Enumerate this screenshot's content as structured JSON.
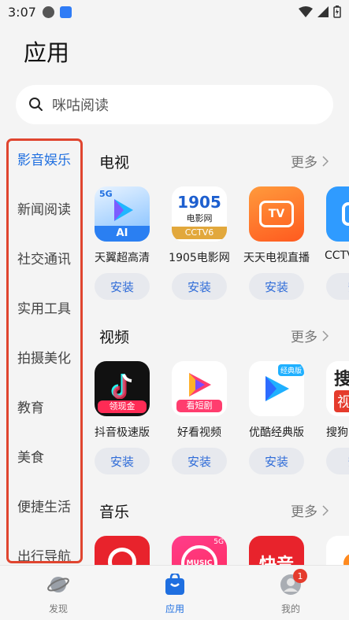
{
  "status_bar": {
    "time": "3:07"
  },
  "page_title": "应用",
  "search": {
    "placeholder": "咪咕阅读"
  },
  "sidebar": {
    "items": [
      {
        "label": "影音娱乐",
        "active": true
      },
      {
        "label": "新闻阅读"
      },
      {
        "label": "社交通讯"
      },
      {
        "label": "实用工具"
      },
      {
        "label": "拍摄美化"
      },
      {
        "label": "教育"
      },
      {
        "label": "美食"
      },
      {
        "label": "便捷生活"
      },
      {
        "label": "出行导航"
      }
    ]
  },
  "sections": [
    {
      "title": "电视",
      "more": "更多",
      "apps": [
        {
          "name": "天翼超高清",
          "install": "安装",
          "icon_badge": "5G",
          "icon_text": "AI"
        },
        {
          "name": "1905电影网",
          "install": "安装",
          "icon_text": "1905",
          "icon_sub": "电影网",
          "icon_tag": "CCTV6"
        },
        {
          "name": "天天电视直播",
          "install": "安装",
          "icon_text": "TV"
        },
        {
          "name": "CCTV",
          "install": "安"
        }
      ]
    },
    {
      "title": "视频",
      "more": "更多",
      "apps": [
        {
          "name": "抖音极速版",
          "install": "安装",
          "icon_tag": "领现金"
        },
        {
          "name": "好看视频",
          "install": "安装",
          "icon_tag": "看短剧"
        },
        {
          "name": "优酷经典版",
          "install": "安装",
          "icon_tag": "经典版"
        },
        {
          "name": "搜狗",
          "install": "安",
          "icon_text": "搜",
          "icon_sub": "视"
        }
      ]
    },
    {
      "title": "音乐",
      "more": "更多",
      "apps": [
        {
          "name": ""
        },
        {
          "name": "",
          "icon_text": "MUSIC",
          "icon_badge": "5G"
        },
        {
          "name": "",
          "icon_text": "快音"
        },
        {
          "name": ""
        }
      ]
    }
  ],
  "tabbar": {
    "items": [
      {
        "label": "发现"
      },
      {
        "label": "应用",
        "active": true
      },
      {
        "label": "我的",
        "badge": "1"
      }
    ]
  },
  "colors": {
    "accent": "#1f6fe0",
    "highlight_border": "#e0452f",
    "install_text": "#2f6cd8"
  }
}
